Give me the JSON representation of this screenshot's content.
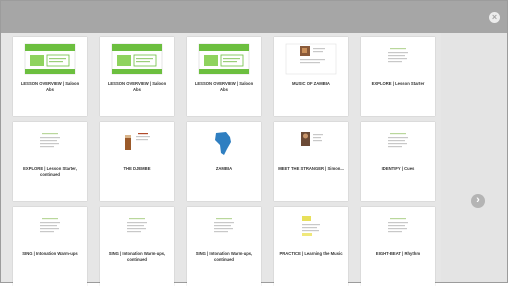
{
  "window": {
    "close_label": "×",
    "next_label": "›"
  },
  "cards": [
    {
      "title": "LESSON OVERVIEW | Saloon Abs",
      "thumb": "green-slide",
      "icon": "slide-thumbnail-icon"
    },
    {
      "title": "LESSON OVERVIEW | Saloon Abs",
      "thumb": "green-slide",
      "icon": "slide-thumbnail-icon"
    },
    {
      "title": "LESSON OVERVIEW | Saloon Abs",
      "thumb": "green-slide",
      "icon": "slide-thumbnail-icon"
    },
    {
      "title": "MUSIC OF ZAMBIA",
      "thumb": "photo",
      "icon": "photo-thumbnail-icon"
    },
    {
      "title": "EXPLORE | Lesson Starter",
      "thumb": "text",
      "icon": "document-thumbnail-icon"
    },
    {
      "title": "EXPLORE | Lesson Starter, continued",
      "thumb": "text",
      "icon": "document-thumbnail-icon"
    },
    {
      "title": "THE DJEMBE",
      "thumb": "drum",
      "icon": "drum-thumbnail-icon"
    },
    {
      "title": "ZAMBIA",
      "thumb": "map",
      "icon": "africa-map-icon"
    },
    {
      "title": "MEET THE STRANGER | Simon...",
      "thumb": "portrait",
      "icon": "portrait-thumbnail-icon"
    },
    {
      "title": "IDENTIFY | Cues",
      "thumb": "text",
      "icon": "document-thumbnail-icon"
    },
    {
      "title": "SING | Intonation Warm-ups",
      "thumb": "text",
      "icon": "document-thumbnail-icon"
    },
    {
      "title": "SING | Intonation Warm-ups, continued",
      "thumb": "text",
      "icon": "document-thumbnail-icon"
    },
    {
      "title": "SING | Intonation Warm-ups, continued",
      "thumb": "text",
      "icon": "document-thumbnail-icon"
    },
    {
      "title": "PRACTICE | Learning the Music",
      "thumb": "yellow",
      "icon": "note-thumbnail-icon"
    },
    {
      "title": "EIGHT-BEAT | Rhythm",
      "thumb": "text",
      "icon": "document-thumbnail-icon"
    }
  ]
}
